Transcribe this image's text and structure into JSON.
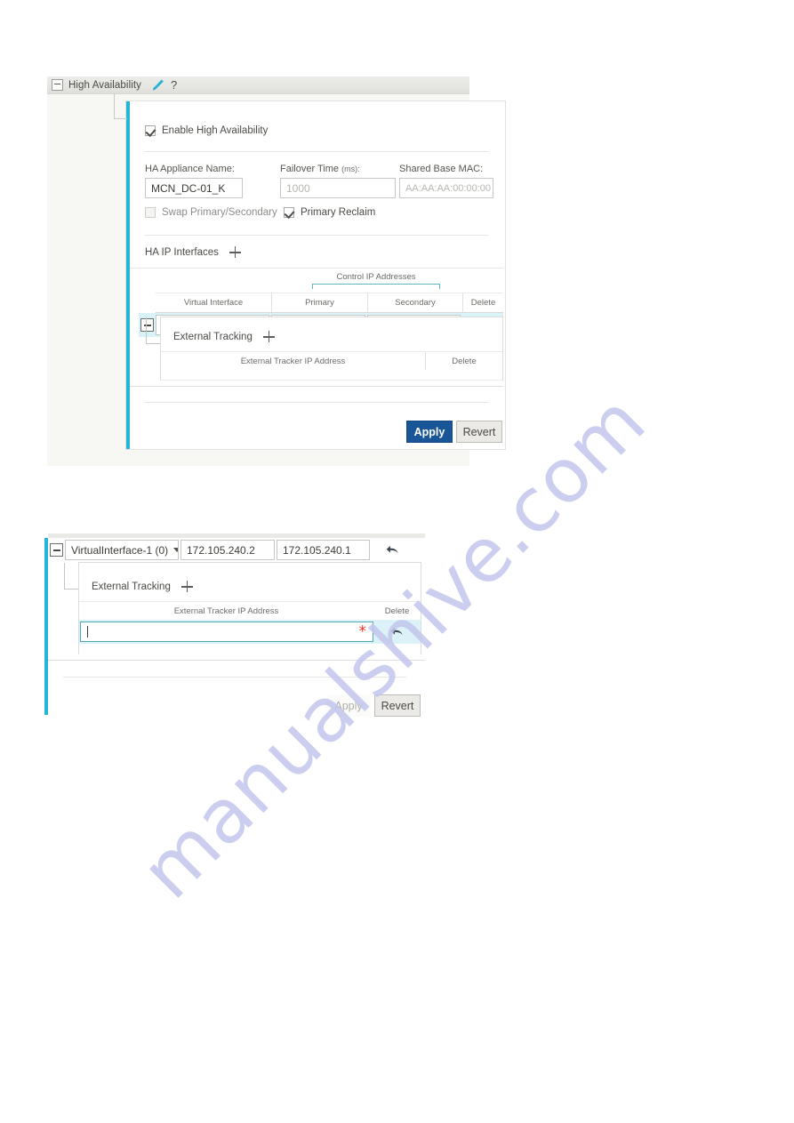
{
  "watermark": {
    "text": "manualshive.com",
    "color": "#c3c6ec"
  },
  "theme": {
    "accent_cyan": "#25b6d6",
    "row_highlight": "#d9f1f8",
    "primary_button": "#1a5598",
    "required_red": "#e3342f",
    "titlebar_bg": "#e6e6e2"
  },
  "panel1": {
    "titlebar": {
      "title": "High Availability",
      "collapse_icon": "minus-box-icon",
      "edit_icon": "pencil-icon",
      "help_icon": "question-mark-icon",
      "help_label": "?"
    },
    "enable_checkbox": {
      "label": "Enable High Availability",
      "checked": true
    },
    "fields": [
      {
        "label": "HA Appliance Name:",
        "value": "MCN_DC-01_K",
        "is_placeholder": false
      },
      {
        "label": "Failover Time",
        "unit": "(ms):",
        "value": "1000",
        "is_placeholder": true
      },
      {
        "label": "Shared Base MAC:",
        "value": "AA:AA:AA:00:00:00",
        "is_placeholder": true
      }
    ],
    "toggles": [
      {
        "label": "Swap Primary/Secondary",
        "checked": false,
        "disabled": true
      },
      {
        "label": "Primary Reclaim",
        "checked": true,
        "disabled": false
      }
    ],
    "ha_interfaces": {
      "section_title": "HA IP Interfaces",
      "add_icon": "plus-icon",
      "group_header": "Control IP Addresses",
      "columns": [
        "Virtual Interface",
        "Primary",
        "Secondary",
        "Delete"
      ],
      "rows": [
        {
          "expander": "minus-box-icon",
          "virtual_interface": "VirtualInterface-1 (0)",
          "primary": "172.105.240.2",
          "secondary": "172.105.240.1",
          "delete_icon": "undo-arrow-icon"
        }
      ]
    },
    "external_tracking": {
      "section_title": "External Tracking",
      "add_icon": "plus-icon",
      "columns": [
        "External Tracker IP Address",
        "Delete"
      ],
      "rows": []
    },
    "footer": {
      "apply_label": "Apply",
      "apply_enabled": true,
      "revert_label": "Revert",
      "revert_enabled": true
    }
  },
  "panel2": {
    "row": {
      "expander": "minus-box-icon",
      "virtual_interface": "VirtualInterface-1 (0)",
      "primary": "172.105.240.2",
      "secondary": "172.105.240.1",
      "delete_icon": "undo-arrow-icon"
    },
    "external_tracking": {
      "section_title": "External Tracking",
      "add_icon": "plus-icon",
      "columns": [
        "External Tracker IP Address",
        "Delete"
      ],
      "new_row": {
        "value": "",
        "required_marker": "*",
        "delete_icon": "undo-arrow-icon"
      }
    },
    "footer": {
      "apply_label": "Apply",
      "apply_enabled": false,
      "revert_label": "Revert",
      "revert_enabled": true
    }
  }
}
